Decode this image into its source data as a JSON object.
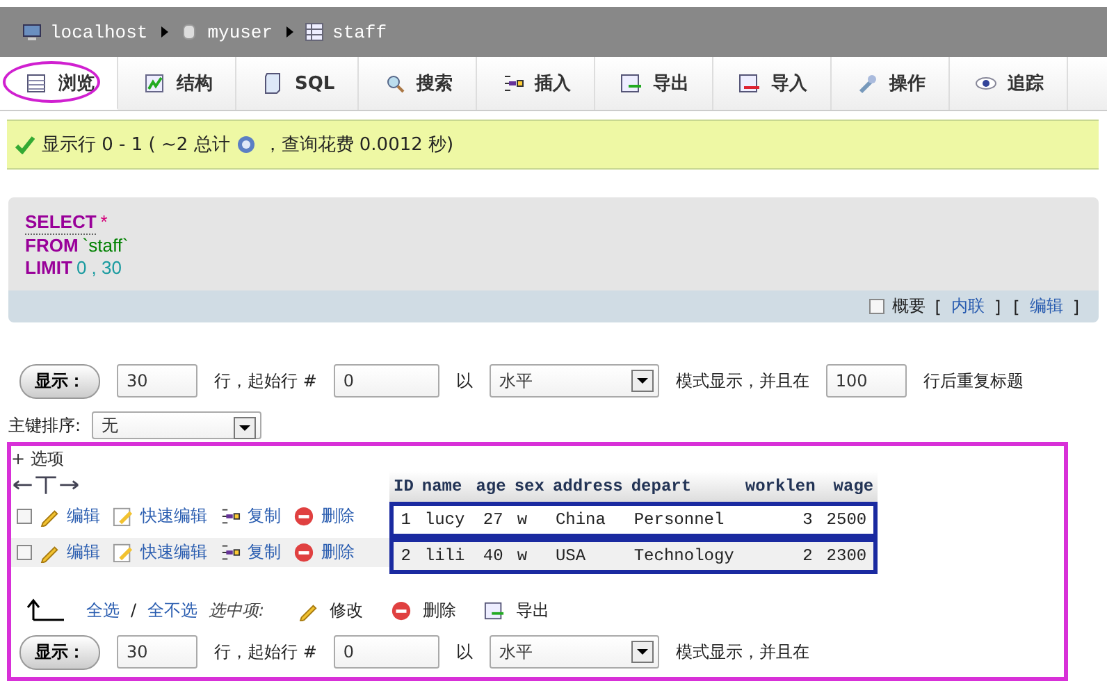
{
  "breadcrumb": [
    {
      "label": "localhost",
      "kind": "server"
    },
    {
      "label": "myuser",
      "kind": "database"
    },
    {
      "label": "staff",
      "kind": "table"
    }
  ],
  "tabs": [
    {
      "label": "浏览",
      "kind": "browse",
      "selected": true
    },
    {
      "label": "结构",
      "kind": "structure",
      "selected": false
    },
    {
      "label": "SQL",
      "kind": "sql",
      "selected": false
    },
    {
      "label": "搜索",
      "kind": "search",
      "selected": false
    },
    {
      "label": "插入",
      "kind": "insert",
      "selected": false
    },
    {
      "label": "导出",
      "kind": "export",
      "selected": false
    },
    {
      "label": "导入",
      "kind": "import",
      "selected": false
    },
    {
      "label": "操作",
      "kind": "operations",
      "selected": false
    },
    {
      "label": "追踪",
      "kind": "tracking",
      "selected": false
    }
  ],
  "notice": {
    "before": "显示行 0 - 1 ( ~2 总计",
    "after": "，查询花费 0.0012 秒)"
  },
  "sql": {
    "lines": [
      {
        "keyword": "SELECT",
        "rest": "*",
        "kind": "operator"
      },
      {
        "keyword": "FROM",
        "rest": "`staff`",
        "kind": "string"
      },
      {
        "keyword": "LIMIT",
        "rest": "0 , 30",
        "kind": "number"
      }
    ],
    "profiling": {
      "label": "概要",
      "checked": false
    },
    "links": [
      {
        "open": "[",
        "label": "内联",
        "close": "]"
      },
      {
        "open": "[",
        "label": "编辑",
        "close": "]"
      }
    ]
  },
  "nav_top": {
    "show_button": "显示：",
    "rows": "30",
    "rows_label": "行，起始行 #",
    "start": "0",
    "mode_label": "以",
    "mode": "水平",
    "display_label": "模式显示，并且在",
    "repeat": "100",
    "repeat_label": "行后重复标题"
  },
  "sort": {
    "label": "主键排序:",
    "value": "无"
  },
  "options_toggle": "+ 选项",
  "table": {
    "columns": [
      {
        "label": "ID",
        "kind": "number"
      },
      {
        "label": "name",
        "kind": "text"
      },
      {
        "label": "age",
        "kind": "number"
      },
      {
        "label": "sex",
        "kind": "text"
      },
      {
        "label": "address",
        "kind": "text"
      },
      {
        "label": "depart",
        "kind": "text"
      },
      {
        "label": "worklen",
        "kind": "number"
      },
      {
        "label": "wage",
        "kind": "number"
      }
    ],
    "rows": [
      {
        "checked": false,
        "actions": [
          {
            "kind": "edit",
            "label": "编辑"
          },
          {
            "kind": "quick_edit",
            "label": "快速编辑"
          },
          {
            "kind": "copy",
            "label": "复制"
          },
          {
            "kind": "delete",
            "label": "删除"
          }
        ],
        "cells": [
          "1",
          "lucy",
          "27",
          "w",
          "China",
          "Personnel",
          "3",
          "2500"
        ]
      },
      {
        "checked": false,
        "actions": [
          {
            "kind": "edit",
            "label": "编辑"
          },
          {
            "kind": "quick_edit",
            "label": "快速编辑"
          },
          {
            "kind": "copy",
            "label": "复制"
          },
          {
            "kind": "delete",
            "label": "删除"
          }
        ],
        "cells": [
          "2",
          "lili",
          "40",
          "w",
          "USA",
          "Technology",
          "2",
          "2300"
        ]
      }
    ]
  },
  "bulk": {
    "check_all": "全选",
    "separator": "/",
    "uncheck_all": "全不选",
    "with_selected": "选中项:",
    "actions": [
      {
        "kind": "edit",
        "label": "修改"
      },
      {
        "kind": "delete",
        "label": "删除"
      },
      {
        "kind": "export",
        "label": "导出"
      }
    ]
  },
  "nav_bottom": {
    "show_button": "显示：",
    "rows": "30",
    "rows_label": "行，起始行 #",
    "start": "0",
    "mode_label": "以",
    "mode": "水平",
    "display_label": "模式显示，并且在"
  }
}
